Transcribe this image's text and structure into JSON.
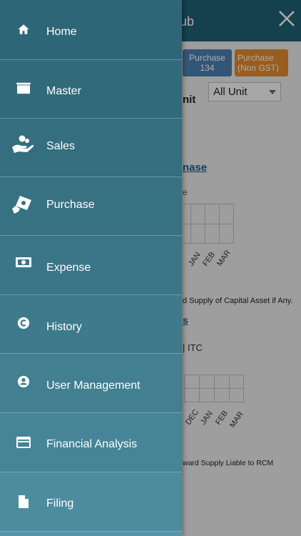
{
  "background": {
    "title_fragment": "ub",
    "chips": [
      {
        "line1": "Purchase",
        "line2": "134"
      },
      {
        "line1": "Purchase",
        "line2": "(Non GST)"
      }
    ],
    "unit_label_fragment": "nit",
    "unit_select_value": "All Unit",
    "link_fragment": "nase",
    "small_label_1": "e",
    "months_1": [
      "JAN",
      "FEB",
      "MAR"
    ],
    "note_1": "d Supply of Capital Asset if Any.",
    "small_label_2": "s",
    "itc_label": "| ITC",
    "months_2": [
      "DEC",
      "JAN",
      "FEB",
      "MAR"
    ],
    "note_2": "ward Supply Liable to RCM"
  },
  "menu": {
    "items": [
      {
        "label": "Home",
        "icon": "home-icon"
      },
      {
        "label": "Master",
        "icon": "folder-icon"
      },
      {
        "label": "Sales",
        "icon": "sales-hand-coin-icon"
      },
      {
        "label": "Purchase",
        "icon": "purchase-hand-cash-icon"
      },
      {
        "label": "Expense",
        "icon": "banknote-icon"
      },
      {
        "label": "History",
        "icon": "history-circle-icon"
      },
      {
        "label": "User Management",
        "icon": "user-account-icon"
      },
      {
        "label": "Financial Analysis",
        "icon": "credit-card-icon"
      },
      {
        "label": "Filing",
        "icon": "file-icon"
      }
    ]
  },
  "colors": {
    "drawer_top": "#2d6475",
    "drawer_bottom": "#5e9aae",
    "header": "#1f5f72",
    "chip_blue": "#4a7fb0",
    "chip_orange": "#e08a2e"
  }
}
